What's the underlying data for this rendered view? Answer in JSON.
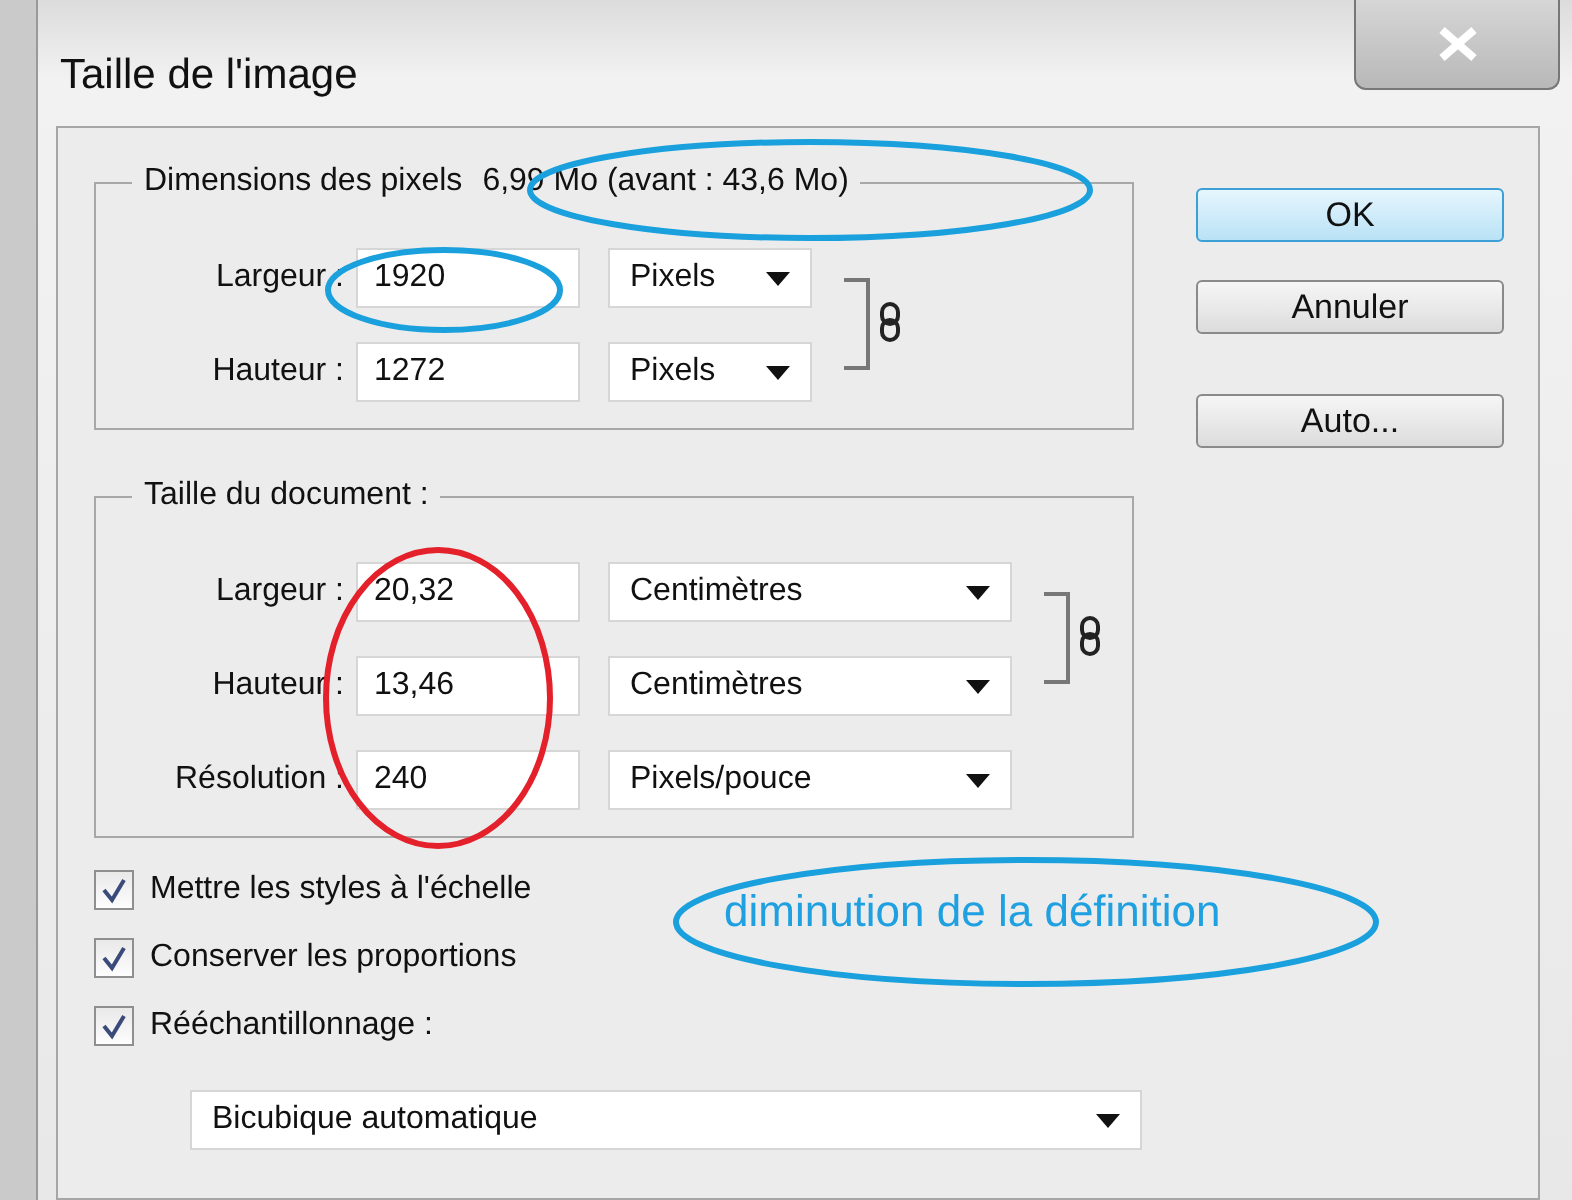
{
  "window": {
    "title": "Taille de l'image"
  },
  "pixel_dimensions": {
    "legend": "Dimensions des pixels",
    "size": "6,99 Mo (avant : 43,6 Mo)",
    "constrained": true,
    "fields": [
      {
        "label": "Largeur :",
        "value": "1920",
        "unit": "Pixels"
      },
      {
        "label": "Hauteur :",
        "value": "1272",
        "unit": "Pixels"
      }
    ]
  },
  "document_size": {
    "legend": "Taille du document :",
    "constrained": true,
    "fields": [
      {
        "label": "Largeur :",
        "value": "20,32",
        "unit": "Centimètres"
      },
      {
        "label": "Hauteur :",
        "value": "13,46",
        "unit": "Centimètres"
      },
      {
        "label": "Résolution :",
        "value": "240",
        "unit": "Pixels/pouce"
      }
    ]
  },
  "options": [
    {
      "label": "Mettre les styles à l'échelle",
      "checked": true
    },
    {
      "label": "Conserver les proportions",
      "checked": true
    },
    {
      "label": "Rééchantillonnage :",
      "checked": true
    }
  ],
  "resample": {
    "value": "Bicubique automatique"
  },
  "buttons": [
    {
      "label": "OK",
      "default": true
    },
    {
      "label": "Annuler",
      "default": false
    },
    {
      "label": "Auto...",
      "default": false
    }
  ],
  "annotation": {
    "note": "diminution de la définition"
  }
}
